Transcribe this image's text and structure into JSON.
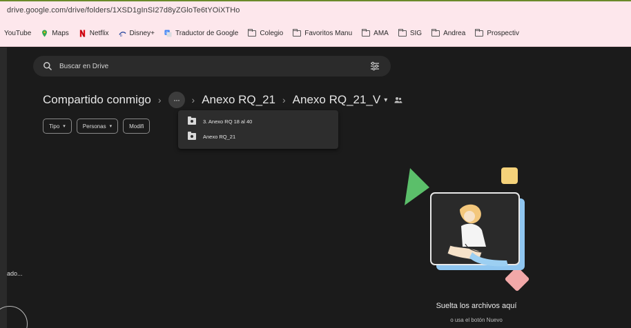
{
  "browser": {
    "url": "drive.google.com/drive/folders/1XSD1gInSI27d8yZGloTe6tYOiXTHo"
  },
  "bookmarks": [
    {
      "label": "YouTube",
      "icon": "youtube-icon"
    },
    {
      "label": "Maps",
      "icon": "maps-icon"
    },
    {
      "label": "Netflix",
      "icon": "netflix-icon"
    },
    {
      "label": "Disney+",
      "icon": "disney-icon"
    },
    {
      "label": "Traductor de Google",
      "icon": "translate-icon"
    },
    {
      "label": "Colegio",
      "icon": "folder-icon"
    },
    {
      "label": "Favoritos Manu",
      "icon": "folder-icon"
    },
    {
      "label": "AMA",
      "icon": "folder-icon"
    },
    {
      "label": "SIG",
      "icon": "folder-icon"
    },
    {
      "label": "Andrea",
      "icon": "folder-icon"
    },
    {
      "label": "Prospectiv",
      "icon": "folder-icon"
    }
  ],
  "search": {
    "placeholder": "Buscar en Drive"
  },
  "breadcrumb": {
    "root": "Compartido conmigo",
    "more": "···",
    "parent": "Anexo RQ_21",
    "current": "Anexo RQ_21_V"
  },
  "filters": [
    {
      "label": "Tipo"
    },
    {
      "label": "Personas"
    },
    {
      "label": "Modifi"
    }
  ],
  "breadcrumb_menu": {
    "items": [
      {
        "label": "3. Anexo RQ 18 al 40"
      },
      {
        "label": "Anexo RQ_21"
      }
    ]
  },
  "sidebar": {
    "truncated_label": "ado..."
  },
  "empty_state": {
    "title": "Suelta los archivos aquí",
    "subtitle": "o usa el botón Nuevo"
  },
  "colors": {
    "background": "#1b1b1b",
    "browser_bar": "#fde7ec",
    "menu": "#2d2d2d"
  }
}
